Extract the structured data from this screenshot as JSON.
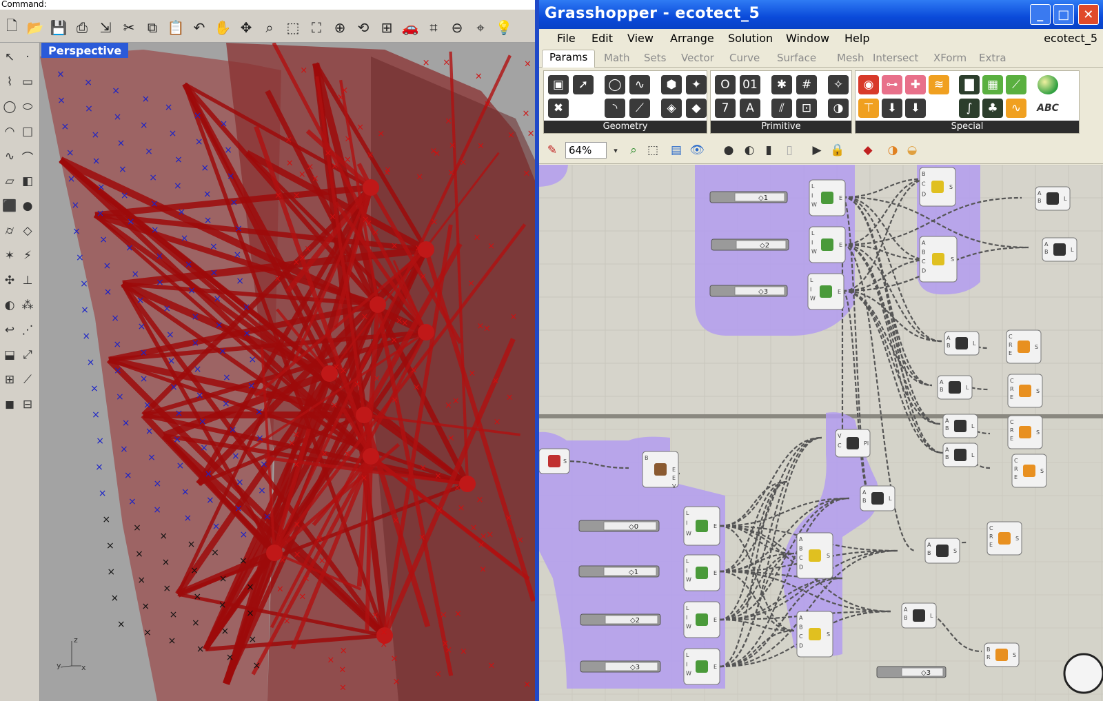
{
  "rhino": {
    "command_label": "Command:",
    "viewport_label": "Perspective",
    "axis": {
      "x": "x",
      "y": "y",
      "z": "z"
    },
    "toolbar_icons": [
      "new-icon",
      "open-icon",
      "save-icon",
      "print-icon",
      "import-icon",
      "cut-icon",
      "copy-icon",
      "paste-icon",
      "undo-icon",
      "pan-icon",
      "rotate-view-icon",
      "zoom-icon",
      "zoom-window-icon",
      "zoom-extents-icon",
      "zoom-selected-icon",
      "rotate-icon",
      "four-viewports-icon",
      "car-icon",
      "grid-icon",
      "cplane-icon",
      "osnap-icon",
      "light-icon"
    ]
  },
  "grasshopper": {
    "title": "Grasshopper - ecotect_5",
    "window_buttons": {
      "minimize": "_",
      "maximize": "□",
      "close": "✕"
    },
    "menu": [
      "File",
      "Edit",
      "View",
      "Arrange",
      "Solution",
      "Window",
      "Help"
    ],
    "document_name": "ecotect_5",
    "tabs": [
      "Params",
      "Math",
      "Sets",
      "Vector",
      "Curve",
      "Surface",
      "Mesh",
      "Intersect",
      "XForm",
      "Extra"
    ],
    "active_tab": "Params",
    "panels": [
      "Geometry",
      "Primitive",
      "Special"
    ],
    "zoom": "64%",
    "sliders": [
      "1",
      "2",
      "3",
      "0",
      "1",
      "2",
      "3",
      "3"
    ]
  },
  "colors": {
    "title_bar": "#0a4ad9",
    "group_fill": "#b39cf0",
    "structure_red": "#9e0a0a",
    "canvas": "#d6d4cb"
  }
}
